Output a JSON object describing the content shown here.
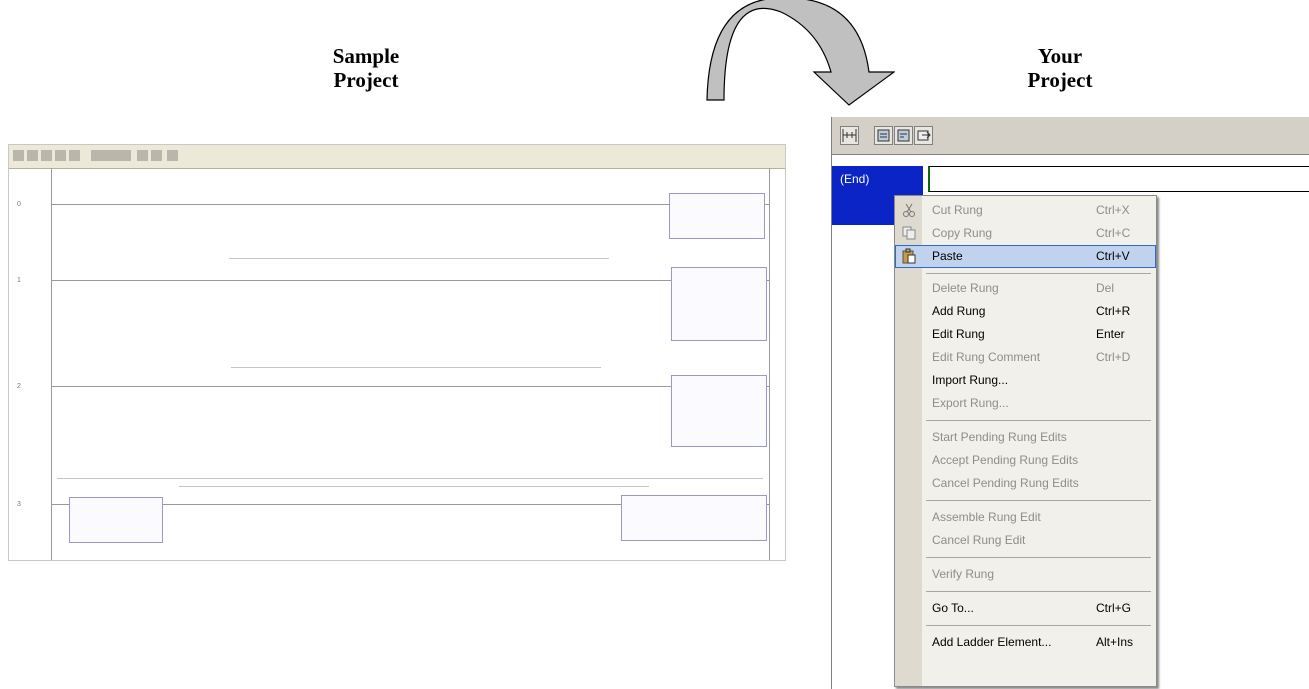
{
  "captions": {
    "left": [
      "Sample",
      "Project"
    ],
    "right": [
      "Your",
      "Project"
    ]
  },
  "sample": {
    "rung_numbers": [
      "0",
      "1",
      "2",
      "3"
    ]
  },
  "your_project": {
    "end_label": "(End)"
  },
  "menu": {
    "items": [
      {
        "label": "Cut Rung",
        "shortcut": "Ctrl+X",
        "state": "disabled",
        "icon": "scissors-icon"
      },
      {
        "label": "Copy Rung",
        "shortcut": "Ctrl+C",
        "state": "disabled",
        "icon": "copy-icon"
      },
      {
        "label": "Paste",
        "shortcut": "Ctrl+V",
        "state": "selected",
        "icon": "paste-icon"
      },
      {
        "label": "Delete Rung",
        "shortcut": "Del",
        "state": "disabled"
      },
      {
        "label": "Add Rung",
        "shortcut": "Ctrl+R",
        "state": "enabled"
      },
      {
        "label": "Edit Rung",
        "shortcut": "Enter",
        "state": "enabled"
      },
      {
        "label": "Edit Rung Comment",
        "shortcut": "Ctrl+D",
        "state": "disabled"
      },
      {
        "label": "Import Rung...",
        "shortcut": "",
        "state": "enabled"
      },
      {
        "label": "Export Rung...",
        "shortcut": "",
        "state": "disabled"
      },
      {
        "label": "Start Pending Rung Edits",
        "shortcut": "",
        "state": "disabled"
      },
      {
        "label": "Accept Pending Rung Edits",
        "shortcut": "",
        "state": "disabled"
      },
      {
        "label": "Cancel Pending Rung Edits",
        "shortcut": "",
        "state": "disabled"
      },
      {
        "label": "Assemble Rung Edit",
        "shortcut": "",
        "state": "disabled"
      },
      {
        "label": "Cancel Rung Edit",
        "shortcut": "",
        "state": "disabled"
      },
      {
        "label": "Verify Rung",
        "shortcut": "",
        "state": "disabled"
      },
      {
        "label": "Go To...",
        "shortcut": "Ctrl+G",
        "state": "enabled"
      },
      {
        "label": "Add Ladder Element...",
        "shortcut": "Alt+Ins",
        "state": "enabled"
      }
    ]
  }
}
